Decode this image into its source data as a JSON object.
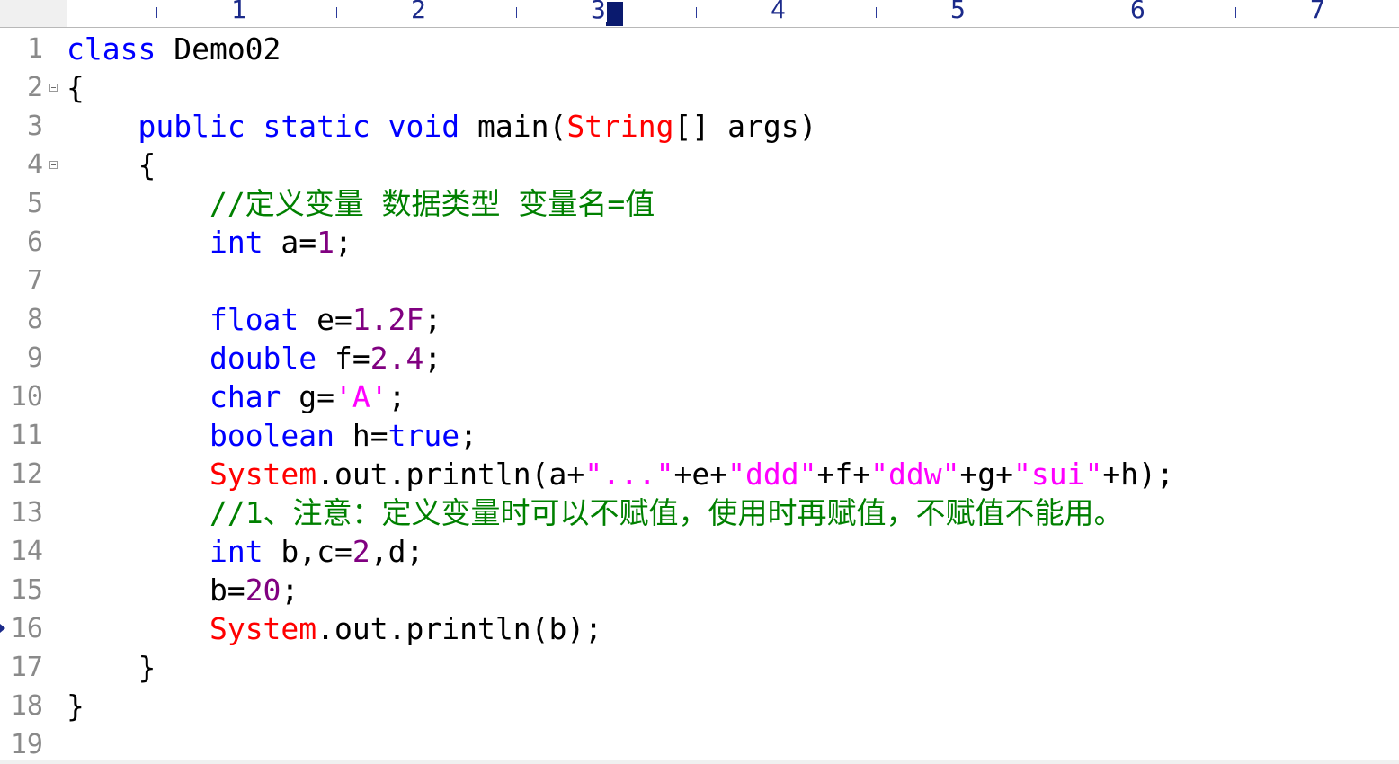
{
  "ruler": {
    "labels": [
      "1",
      "2",
      "3",
      "4",
      "5",
      "6",
      "7"
    ]
  },
  "editor": {
    "colors": {
      "keyword": "#0000ff",
      "number": "#800080",
      "string": "#ff00ff",
      "system": "#ff0000",
      "comment": "#008000",
      "line_number": "#8a8a8a"
    },
    "current_line": 16,
    "lines": [
      {
        "num": "1",
        "fold": false,
        "tokens": [
          {
            "t": "kw",
            "v": "class"
          },
          {
            "t": "plain",
            "v": " Demo02"
          }
        ]
      },
      {
        "num": "2",
        "fold": true,
        "tokens": [
          {
            "t": "plain",
            "v": "{"
          }
        ]
      },
      {
        "num": "3",
        "fold": false,
        "tokens": [
          {
            "t": "plain",
            "v": "    "
          },
          {
            "t": "kw",
            "v": "public static void"
          },
          {
            "t": "plain",
            "v": " main("
          },
          {
            "t": "sys",
            "v": "String"
          },
          {
            "t": "plain",
            "v": "[] args)"
          }
        ]
      },
      {
        "num": "4",
        "fold": true,
        "tokens": [
          {
            "t": "plain",
            "v": "    {"
          }
        ]
      },
      {
        "num": "5",
        "fold": false,
        "tokens": [
          {
            "t": "plain",
            "v": "        "
          },
          {
            "t": "com",
            "v": "//定义变量 数据类型 变量名=值"
          }
        ]
      },
      {
        "num": "6",
        "fold": false,
        "tokens": [
          {
            "t": "plain",
            "v": "        "
          },
          {
            "t": "kw",
            "v": "int"
          },
          {
            "t": "plain",
            "v": " a="
          },
          {
            "t": "num",
            "v": "1"
          },
          {
            "t": "plain",
            "v": ";"
          }
        ]
      },
      {
        "num": "7",
        "fold": false,
        "tokens": []
      },
      {
        "num": "8",
        "fold": false,
        "tokens": [
          {
            "t": "plain",
            "v": "        "
          },
          {
            "t": "kw",
            "v": "float"
          },
          {
            "t": "plain",
            "v": " e="
          },
          {
            "t": "num",
            "v": "1.2F"
          },
          {
            "t": "plain",
            "v": ";"
          }
        ]
      },
      {
        "num": "9",
        "fold": false,
        "tokens": [
          {
            "t": "plain",
            "v": "        "
          },
          {
            "t": "kw",
            "v": "double"
          },
          {
            "t": "plain",
            "v": " f="
          },
          {
            "t": "num",
            "v": "2.4"
          },
          {
            "t": "plain",
            "v": ";"
          }
        ]
      },
      {
        "num": "10",
        "fold": false,
        "tokens": [
          {
            "t": "plain",
            "v": "        "
          },
          {
            "t": "kw",
            "v": "char"
          },
          {
            "t": "plain",
            "v": " g="
          },
          {
            "t": "str",
            "v": "'A'"
          },
          {
            "t": "plain",
            "v": ";"
          }
        ]
      },
      {
        "num": "11",
        "fold": false,
        "tokens": [
          {
            "t": "plain",
            "v": "        "
          },
          {
            "t": "kw",
            "v": "boolean"
          },
          {
            "t": "plain",
            "v": " h="
          },
          {
            "t": "kw",
            "v": "true"
          },
          {
            "t": "plain",
            "v": ";"
          }
        ]
      },
      {
        "num": "12",
        "fold": false,
        "tokens": [
          {
            "t": "plain",
            "v": "        "
          },
          {
            "t": "sys",
            "v": "System"
          },
          {
            "t": "plain",
            "v": ".out.println(a+"
          },
          {
            "t": "str",
            "v": "\"...\""
          },
          {
            "t": "plain",
            "v": "+e+"
          },
          {
            "t": "str",
            "v": "\"ddd\""
          },
          {
            "t": "plain",
            "v": "+f+"
          },
          {
            "t": "str",
            "v": "\"ddw\""
          },
          {
            "t": "plain",
            "v": "+g+"
          },
          {
            "t": "str",
            "v": "\"sui\""
          },
          {
            "t": "plain",
            "v": "+h);"
          }
        ]
      },
      {
        "num": "13",
        "fold": false,
        "tokens": [
          {
            "t": "plain",
            "v": "        "
          },
          {
            "t": "com",
            "v": "//1、注意：定义变量时可以不赋值，使用时再赋值，不赋值不能用。"
          }
        ]
      },
      {
        "num": "14",
        "fold": false,
        "tokens": [
          {
            "t": "plain",
            "v": "        "
          },
          {
            "t": "kw",
            "v": "int"
          },
          {
            "t": "plain",
            "v": " b,c="
          },
          {
            "t": "num",
            "v": "2"
          },
          {
            "t": "plain",
            "v": ",d;"
          }
        ]
      },
      {
        "num": "15",
        "fold": false,
        "tokens": [
          {
            "t": "plain",
            "v": "        b="
          },
          {
            "t": "num",
            "v": "20"
          },
          {
            "t": "plain",
            "v": ";"
          }
        ]
      },
      {
        "num": "16",
        "fold": false,
        "tokens": [
          {
            "t": "plain",
            "v": "        "
          },
          {
            "t": "sys",
            "v": "System"
          },
          {
            "t": "plain",
            "v": ".out.println(b);"
          }
        ]
      },
      {
        "num": "17",
        "fold": false,
        "tokens": [
          {
            "t": "plain",
            "v": "    }"
          }
        ]
      },
      {
        "num": "18",
        "fold": false,
        "tokens": [
          {
            "t": "plain",
            "v": "}"
          }
        ]
      },
      {
        "num": "19",
        "fold": false,
        "tokens": []
      }
    ]
  }
}
